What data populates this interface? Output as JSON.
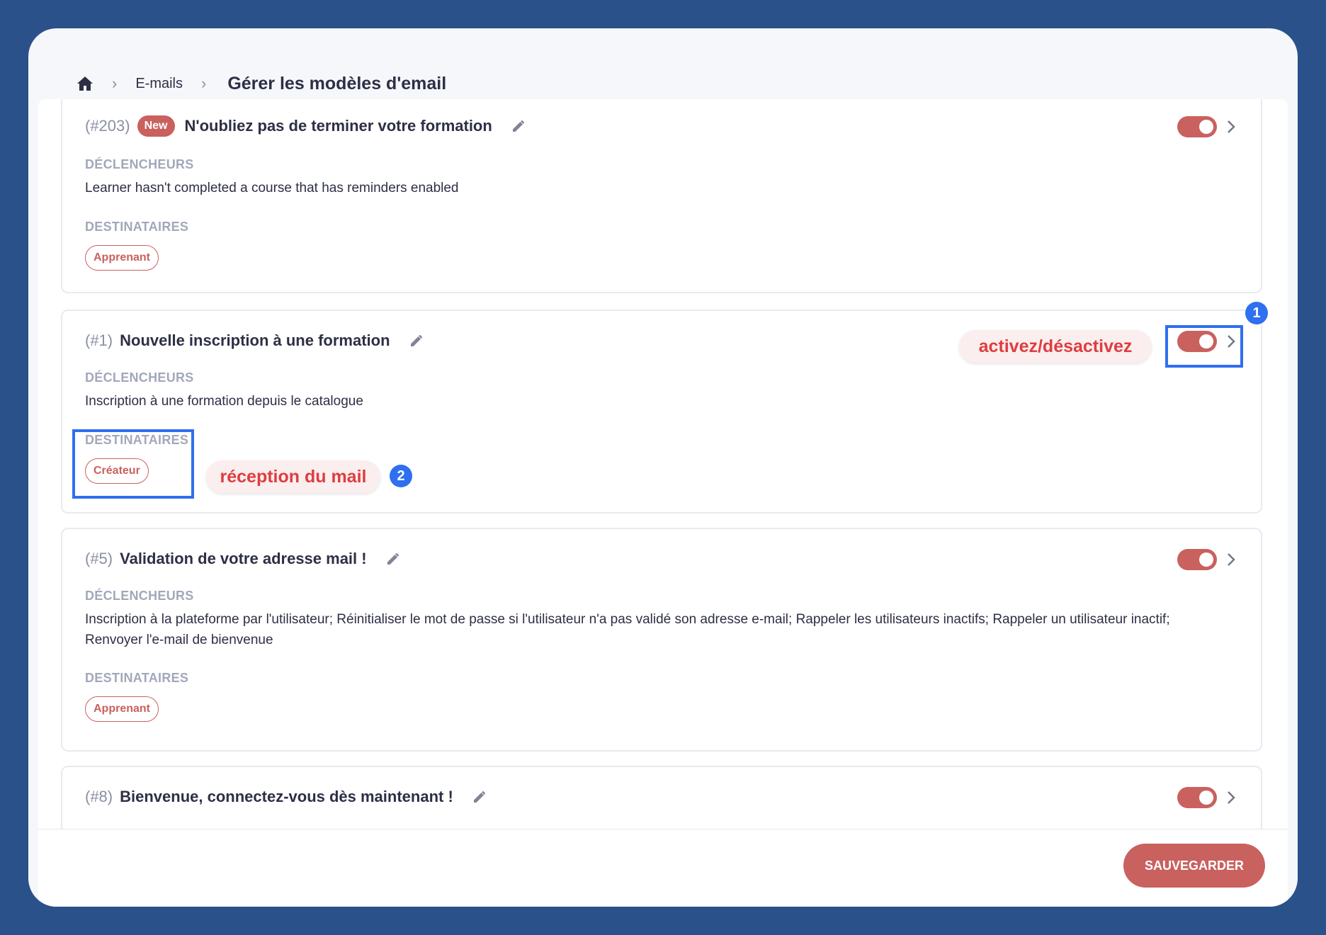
{
  "breadcrumb": {
    "level1": "E-mails",
    "current": "Gérer les modèles d'email"
  },
  "templates": [
    {
      "id": "(#203)",
      "badge": "New",
      "title": "N'oubliez pas de terminer votre formation",
      "triggers_label": "DÉCLENCHEURS",
      "triggers": "Learner hasn't completed a course that has reminders enabled",
      "recipients_label": "DESTINATAIRES",
      "recipient": "Apprenant",
      "enabled": true
    },
    {
      "id": "(#1)",
      "title": "Nouvelle inscription à une formation",
      "triggers_label": "DÉCLENCHEURS",
      "triggers": "Inscription à une formation depuis le catalogue",
      "recipients_label": "DESTINATAIRES",
      "recipient": "Créateur",
      "enabled": true
    },
    {
      "id": "(#5)",
      "title": "Validation de votre adresse mail !",
      "triggers_label": "DÉCLENCHEURS",
      "triggers": "Inscription à la plateforme par l'utilisateur; Réinitialiser le mot de passe si l'utilisateur n'a pas validé son adresse e-mail; Rappeler les utilisateurs inactifs; Rappeler un utilisateur inactif; Renvoyer l'e-mail de bienvenue",
      "recipients_label": "DESTINATAIRES",
      "recipient": "Apprenant",
      "enabled": true
    },
    {
      "id": "(#8)",
      "title": "Bienvenue, connectez-vous dès maintenant !",
      "enabled": true
    }
  ],
  "footer": {
    "save_label": "SAUVEGARDER"
  },
  "annotations": {
    "toggle_callout": "activez/désactivez",
    "toggle_number": "1",
    "recipients_callout": "réception du mail",
    "recipients_number": "2"
  },
  "colors": {
    "accent": "#c9615f",
    "highlight": "#2f6ff0",
    "background": "#2a5189",
    "callout_text": "#de3d40"
  },
  "icons": [
    "home-icon",
    "chevron-right-icon",
    "pencil-icon",
    "toggle-switch"
  ]
}
